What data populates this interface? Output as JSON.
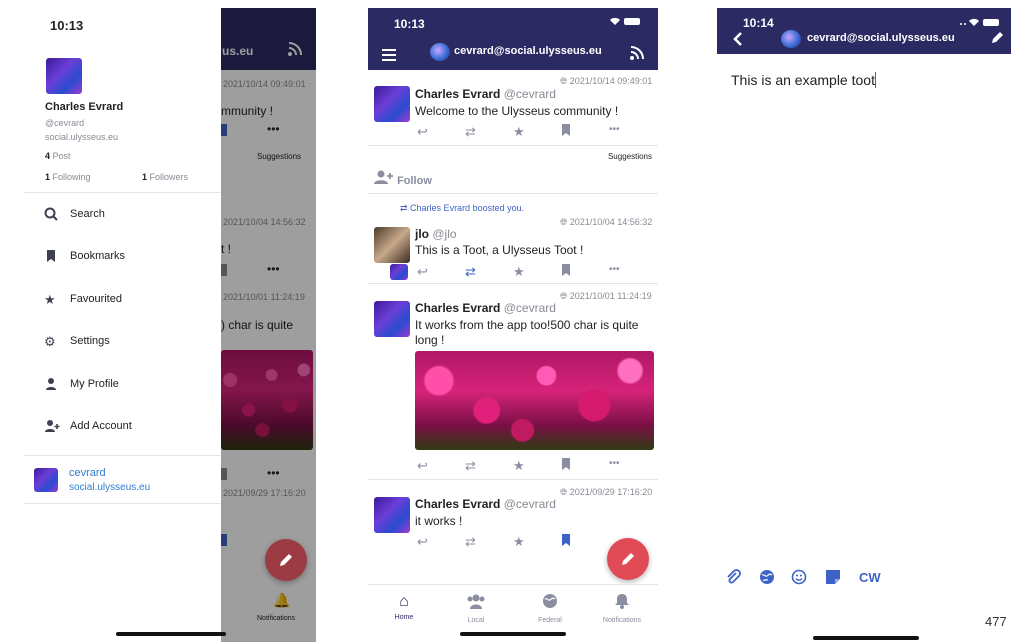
{
  "screen1": {
    "status_time": "10:13",
    "profile": {
      "name": "Charles Evrard",
      "handle": "@cevrard",
      "instance": "social.ulysseus.eu"
    },
    "stats": {
      "post_count": "4",
      "post_label": "Post",
      "following_count": "1",
      "following_label": "Following",
      "followers_count": "1",
      "followers_label": "Followers"
    },
    "menu": [
      {
        "icon": "search-icon",
        "label": "Search"
      },
      {
        "icon": "bookmark-icon",
        "label": "Bookmarks"
      },
      {
        "icon": "star-icon",
        "label": "Favourited"
      },
      {
        "icon": "gear-icon",
        "label": "Settings"
      },
      {
        "icon": "user-icon",
        "label": "My Profile"
      },
      {
        "icon": "add-user-icon",
        "label": "Add Account"
      }
    ],
    "account": {
      "name": "cevrard",
      "instance": "social.ulysseus.eu"
    },
    "background": {
      "title_fragment": "us.eu",
      "date1": "2021/10/14 09:49:01",
      "text1": "mmunity !",
      "suggestions": "Suggestions",
      "date2": "2021/10/04 14:56:32",
      "text2": "t !",
      "date3": "2021/10/01 11:24:19",
      "text3": ") char is quite",
      "date4": "2021/09/29 17:16:20",
      "notifications": "Notifications"
    }
  },
  "screen2": {
    "status_time": "10:13",
    "header_title": "cevrard@social.ulysseus.eu",
    "toots": [
      {
        "name": "Charles Evrard",
        "handle": "@cevrard",
        "date": "2021/10/14 09:49:01",
        "text": "Welcome to the Ulysseus community !"
      },
      {
        "name": "jlo",
        "handle": "@jlo",
        "date": "2021/10/04 14:56:32",
        "text": "This is a Toot, a Ulysseus Toot !",
        "boost_notice": "Charles Evrard boosted you."
      },
      {
        "name": "Charles Evrard",
        "handle": "@cevrard",
        "date": "2021/10/01 11:24:19",
        "text": "It works from the app too!500 char is quite long !"
      },
      {
        "name": "Charles Evrard",
        "handle": "@cevrard",
        "date": "2021/09/29 17:16:20",
        "text": "it works !"
      }
    ],
    "suggestions": "Suggestions",
    "follow": "Follow",
    "tabs": [
      "Home",
      "Local",
      "Federal",
      "Notifications"
    ],
    "accent": "#2c2a63",
    "fab_color": "#e04b55"
  },
  "screen3": {
    "status_time": "10:14",
    "header_title": "cevrard@social.ulysseus.eu",
    "compose_text": "This is an example toot",
    "cw_label": "CW",
    "char_count": "477"
  }
}
